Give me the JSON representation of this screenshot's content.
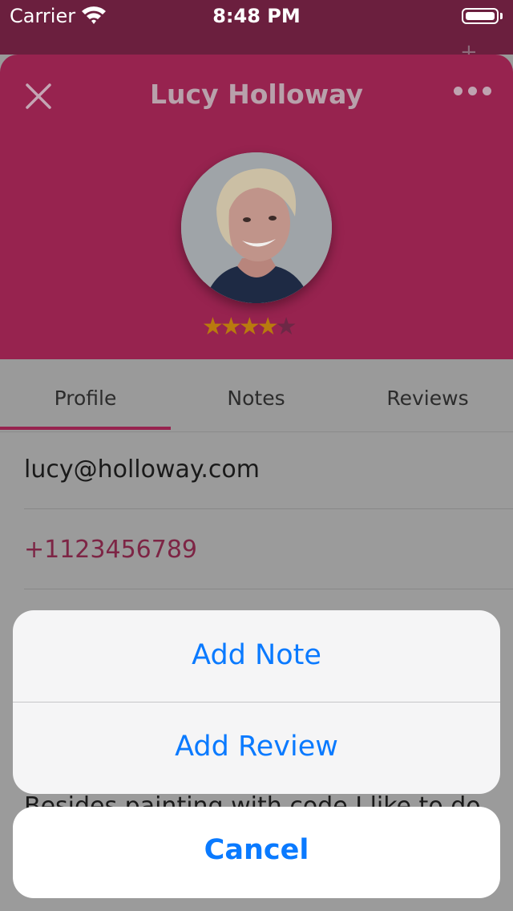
{
  "status_bar": {
    "carrier": "Carrier",
    "time": "8:48 PM"
  },
  "header": {
    "title": "Lucy Holloway",
    "rating": 4,
    "rating_max": 5,
    "accent_color": "#97234f"
  },
  "tabs": [
    {
      "label": "Profile",
      "active": true
    },
    {
      "label": "Notes",
      "active": false
    },
    {
      "label": "Reviews",
      "active": false
    }
  ],
  "profile": {
    "email": "lucy@holloway.com",
    "phone": "+1123456789",
    "bio_peek": "Besides painting with code I like to do"
  },
  "action_sheet": {
    "actions": [
      {
        "label": "Add Note"
      },
      {
        "label": "Add Review"
      }
    ],
    "cancel_label": "Cancel",
    "action_color": "#0a7aff"
  }
}
